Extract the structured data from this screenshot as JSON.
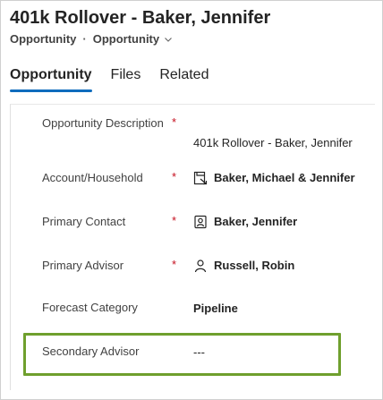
{
  "header": {
    "title": "401k Rollover - Baker, Jennifer",
    "entity_type": "Opportunity",
    "separator": "·",
    "form_selector": "Opportunity"
  },
  "tabs": [
    {
      "label": "Opportunity",
      "active": true
    },
    {
      "label": "Files",
      "active": false
    },
    {
      "label": "Related",
      "active": false
    }
  ],
  "fields": {
    "description": {
      "label": "Opportunity Description",
      "required": "*",
      "value": "401k Rollover - Baker, Jennifer"
    },
    "household": {
      "label": "Account/Household",
      "required": "*",
      "value": "Baker, Michael & Jennifer",
      "icon": "account-icon"
    },
    "primary_contact": {
      "label": "Primary Contact",
      "required": "*",
      "value": "Baker, Jennifer",
      "icon": "contact-card-icon"
    },
    "primary_advisor": {
      "label": "Primary Advisor",
      "required": "*",
      "value": "Russell, Robin",
      "icon": "person-icon"
    },
    "forecast": {
      "label": "Forecast Category",
      "value": "Pipeline"
    },
    "secondary_advisor": {
      "label": "Secondary Advisor",
      "value": "---"
    }
  },
  "colors": {
    "accent": "#0f6cbd",
    "required": "#c50f1f",
    "highlight": "#6f9f2d"
  }
}
